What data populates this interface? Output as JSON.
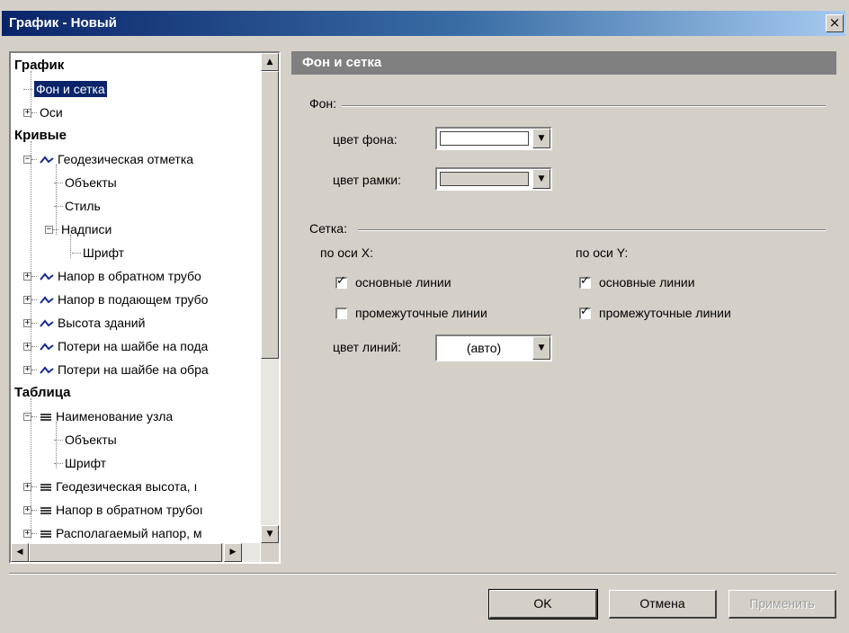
{
  "window": {
    "title": "График - Новый",
    "close_glyph": "×"
  },
  "tree": {
    "rows": [
      {
        "label": "График",
        "type": "header"
      },
      {
        "label": "Фон и сетка",
        "selected": true
      },
      {
        "label": "Оси"
      },
      {
        "label": "Кривые",
        "type": "header"
      },
      {
        "label": "Геодезическая отметка",
        "icon": "curve-icon"
      },
      {
        "label": "Объекты"
      },
      {
        "label": "Стиль"
      },
      {
        "label": "Надписи"
      },
      {
        "label": "Шрифт"
      },
      {
        "label": "Напор в обратном трубо",
        "icon": "curve-icon"
      },
      {
        "label": "Напор в подающем трубо",
        "icon": "curve-icon"
      },
      {
        "label": "Высота зданий",
        "icon": "curve-icon"
      },
      {
        "label": "Потери на шайбе на пода",
        "icon": "curve-icon"
      },
      {
        "label": "Потери на шайбе на обра",
        "icon": "curve-icon"
      },
      {
        "label": "Таблица",
        "type": "header"
      },
      {
        "label": "Наименование узла",
        "icon": "table-icon"
      },
      {
        "label": "Объекты"
      },
      {
        "label": "Шрифт"
      },
      {
        "label": "Геодезическая высота, ı",
        "icon": "table-icon"
      },
      {
        "label": "Напор в обратном трубоı",
        "icon": "table-icon"
      },
      {
        "label": "Располагаемый напор, м",
        "icon": "table-icon"
      }
    ],
    "expander_plus": "+",
    "expander_minus": "−"
  },
  "panel": {
    "header": "Фон и сетка",
    "background_group": "Фон:",
    "bg_color_label": "цвет фона:",
    "frame_color_label": "цвет рамки:",
    "grid_group": "Сетка:",
    "x_axis_label": "по оси X:",
    "y_axis_label": "по оси Y:",
    "major_lines": "основные линии",
    "minor_lines": "промежуточные линии",
    "line_color_label": "цвет линий:",
    "line_color_value": "(авто)",
    "x_major_checked": true,
    "x_minor_checked": false,
    "y_major_checked": true,
    "y_minor_checked": true,
    "bg_color": "#ffffff",
    "frame_color": "#d4d0c8"
  },
  "buttons": {
    "ok": "OK",
    "cancel": "Отмена",
    "apply": "Применить"
  }
}
